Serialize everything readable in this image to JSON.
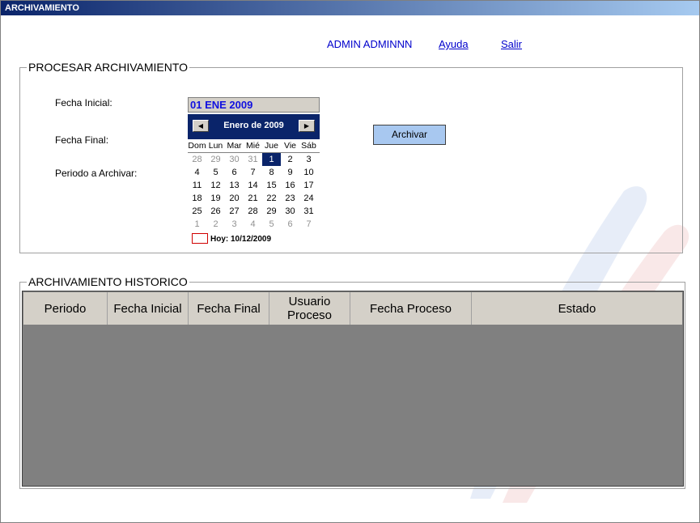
{
  "window": {
    "title": "ARCHIVAMIENTO"
  },
  "header": {
    "user": "ADMIN ADMINNN",
    "help_link": "Ayuda",
    "exit_link": "Salir"
  },
  "process_section": {
    "legend": "PROCESAR ARCHIVAMIENTO",
    "labels": {
      "start_date": "Fecha Inicial:",
      "end_date": "Fecha Final:",
      "period": "Periodo a Archivar:"
    },
    "start_date_value": "01 ENE 2009",
    "archive_button": "Archivar"
  },
  "calendar": {
    "month_title": "Enero de 2009",
    "prev_icon": "◀",
    "next_icon": "▶",
    "weekdays": [
      "Dom",
      "Lun",
      "Mar",
      "Mié",
      "Jue",
      "Vie",
      "Sáb"
    ],
    "weeks": [
      [
        {
          "d": "28",
          "o": true
        },
        {
          "d": "29",
          "o": true
        },
        {
          "d": "30",
          "o": true
        },
        {
          "d": "31",
          "o": true
        },
        {
          "d": "1",
          "s": true
        },
        {
          "d": "2"
        },
        {
          "d": "3"
        }
      ],
      [
        {
          "d": "4"
        },
        {
          "d": "5"
        },
        {
          "d": "6"
        },
        {
          "d": "7"
        },
        {
          "d": "8"
        },
        {
          "d": "9"
        },
        {
          "d": "10"
        }
      ],
      [
        {
          "d": "11"
        },
        {
          "d": "12"
        },
        {
          "d": "13"
        },
        {
          "d": "14"
        },
        {
          "d": "15"
        },
        {
          "d": "16"
        },
        {
          "d": "17"
        }
      ],
      [
        {
          "d": "18"
        },
        {
          "d": "19"
        },
        {
          "d": "20"
        },
        {
          "d": "21"
        },
        {
          "d": "22"
        },
        {
          "d": "23"
        },
        {
          "d": "24"
        }
      ],
      [
        {
          "d": "25"
        },
        {
          "d": "26"
        },
        {
          "d": "27"
        },
        {
          "d": "28"
        },
        {
          "d": "29"
        },
        {
          "d": "30"
        },
        {
          "d": "31"
        }
      ],
      [
        {
          "d": "1",
          "o": true
        },
        {
          "d": "2",
          "o": true
        },
        {
          "d": "3",
          "o": true
        },
        {
          "d": "4",
          "o": true
        },
        {
          "d": "5",
          "o": true
        },
        {
          "d": "6",
          "o": true
        },
        {
          "d": "7",
          "o": true
        }
      ]
    ],
    "today": "Hoy: 10/12/2009"
  },
  "history_section": {
    "legend": "ARCHIVAMIENTO HISTORICO",
    "columns": [
      "Periodo",
      "Fecha Inicial",
      "Fecha Final",
      "Usuario Proceso",
      "Fecha Proceso",
      "Estado"
    ],
    "rows": []
  },
  "colors": {
    "titlebar": "#0a246a",
    "accent": "#a8c8f0",
    "link": "#0000cc"
  }
}
